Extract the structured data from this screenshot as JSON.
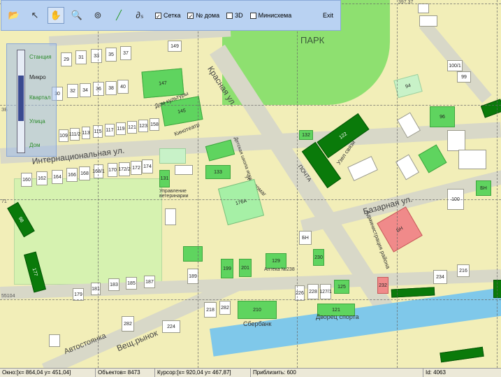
{
  "toolbar": {
    "checkboxes": [
      {
        "label": "Сетка",
        "checked": true
      },
      {
        "label": "№ дома",
        "checked": true
      },
      {
        "label": "3D",
        "checked": false
      },
      {
        "label": "Минисхема",
        "checked": false
      }
    ],
    "exit_label": "Exit"
  },
  "zoom_panel": {
    "labels": [
      "Станция",
      "Микро",
      "Квартал",
      "Улица",
      "Дом"
    ],
    "level": 0.45
  },
  "map": {
    "park_label": "ПАРК",
    "streets": {
      "krasnaya": "Красная ул.",
      "internatsionalnaya": "Интернациональная ул.",
      "bazarnaya": "Базарная ул.",
      "avtostoyanka": "Автостоянка",
      "veshch_rynok": "Вещ.рынок",
      "dom_kultury": "Дом культуры",
      "kinoteatr": "Кинотеатр",
      "detskaya_shkola": "Детская школа искусств",
      "univermag": "Универмаг",
      "pochta": "ПОЧТА",
      "uzel_svyazi": "Узел связи",
      "upravlenie": "Управление ветеринарии",
      "administratsiya": "Администрация района",
      "apteka": "Аптека №238",
      "sberbank": "Сбербанк",
      "dvorets_sporta": "Дворец спорта"
    },
    "coords": [
      "397,37",
      "55104",
      "71",
      "ЗБ"
    ],
    "building_numbers": [
      "29",
      "31",
      "33",
      "35",
      "37",
      "149",
      "30",
      "32",
      "34",
      "36",
      "38",
      "40",
      "147",
      "145",
      "109",
      "111/2",
      "113",
      "115",
      "117",
      "119",
      "121",
      "123",
      "158",
      "160",
      "162",
      "164",
      "166",
      "168",
      "168/1",
      "170",
      "172/2",
      "172",
      "174",
      "131",
      "133",
      "176А",
      "132",
      "122",
      "БН",
      "БН",
      "БН",
      "100",
      "98",
      "177",
      "179",
      "181",
      "183",
      "185",
      "187",
      "189",
      "199",
      "201",
      "129",
      "230",
      "232",
      "234",
      "216",
      "218",
      "282",
      "210",
      "282",
      "224",
      "226",
      "228",
      "127/1",
      "125",
      "121",
      "123",
      "96",
      "94",
      "100/1",
      "99"
    ]
  },
  "status": {
    "window": "Окно:[x= 864,04 y= 451,04]",
    "objects": "Объектов= 8473",
    "cursor": "Курсор:[x= 920,04 y= 467,87]",
    "zoom": "Приблизить: 600",
    "id": "Id: 4063"
  }
}
